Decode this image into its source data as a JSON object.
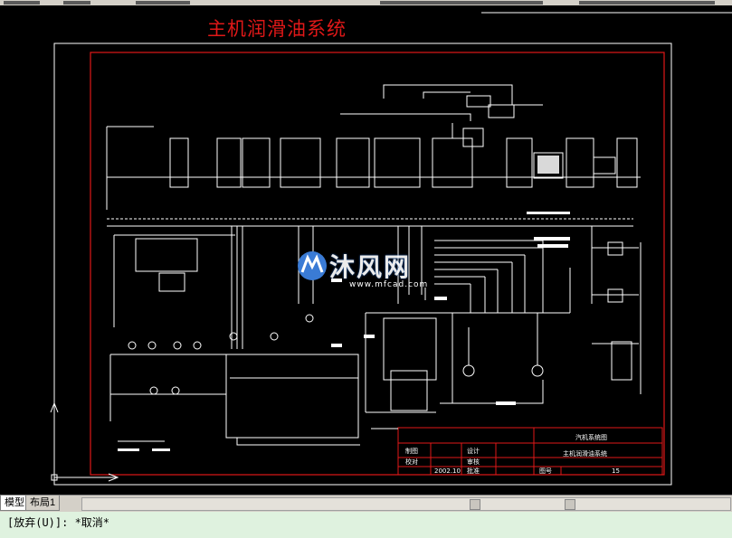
{
  "drawing": {
    "title": "主机润滑油系统",
    "title_block": {
      "project": "汽机系统图",
      "drawing_name": "主机润滑油系统",
      "date": "2002.10",
      "sheet_no": "15",
      "roles": [
        "制图",
        "设计",
        "校对",
        "审核",
        "批准"
      ],
      "sheet_label": "图号"
    },
    "colors": {
      "frame": "#e01818",
      "lines": "#ffffff",
      "background": "#000000"
    }
  },
  "watermark": {
    "text": "沐风网",
    "url": "www.mfcad.com",
    "icon": "mf-logo-icon"
  },
  "tabs": [
    {
      "label": "模型",
      "active": true
    },
    {
      "label": "布局1",
      "active": false
    }
  ],
  "command_line": {
    "text": "[放弃(U)]: *取消*"
  },
  "ucs": {
    "icon": "ucs-axis-icon"
  }
}
